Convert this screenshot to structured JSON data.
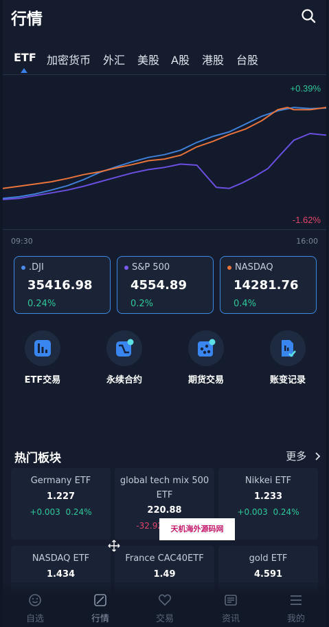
{
  "header": {
    "title": "行情",
    "search_icon": "search-icon"
  },
  "tabs": [
    {
      "label": "ETF",
      "active": true
    },
    {
      "label": "加密货币",
      "active": false
    },
    {
      "label": "外汇",
      "active": false
    },
    {
      "label": "美股",
      "active": false
    },
    {
      "label": "A股",
      "active": false
    },
    {
      "label": "港股",
      "active": false
    },
    {
      "label": "台股",
      "active": false
    }
  ],
  "chart_data": {
    "type": "line",
    "x_range": [
      "09:30",
      "16:00"
    ],
    "top_label": "+0.39%",
    "bottom_label": "-1.62%",
    "ylim": [
      -1.62,
      0.39
    ],
    "series": [
      {
        "name": ".DJI",
        "color": "#3f7fd6",
        "x": [
          0,
          0.05,
          0.1,
          0.15,
          0.2,
          0.25,
          0.3,
          0.35,
          0.4,
          0.45,
          0.5,
          0.55,
          0.6,
          0.65,
          0.7,
          0.75,
          0.8,
          0.85,
          0.9,
          0.95,
          1
        ],
        "values": [
          -1.5,
          -1.47,
          -1.42,
          -1.35,
          -1.27,
          -1.16,
          -1.03,
          -0.93,
          -0.84,
          -0.76,
          -0.71,
          -0.63,
          -0.49,
          -0.38,
          -0.3,
          -0.16,
          -0.02,
          0.08,
          0.14,
          0.12,
          0.13
        ]
      },
      {
        "name": "S&P 500",
        "color": "#6a4fe0",
        "x": [
          0,
          0.05,
          0.1,
          0.15,
          0.2,
          0.25,
          0.3,
          0.35,
          0.4,
          0.45,
          0.5,
          0.55,
          0.6,
          0.63,
          0.66,
          0.7,
          0.74,
          0.78,
          0.82,
          0.86,
          0.9,
          0.95,
          1
        ],
        "values": [
          -1.52,
          -1.5,
          -1.45,
          -1.4,
          -1.35,
          -1.28,
          -1.2,
          -1.12,
          -1.04,
          -0.98,
          -0.94,
          -0.88,
          -0.9,
          -1.1,
          -1.3,
          -1.32,
          -1.22,
          -1.1,
          -0.96,
          -0.7,
          -0.45,
          -0.33,
          -0.36
        ]
      },
      {
        "name": "NASDAQ",
        "color": "#e8743b",
        "x": [
          0,
          0.05,
          0.1,
          0.15,
          0.2,
          0.25,
          0.3,
          0.35,
          0.4,
          0.45,
          0.5,
          0.55,
          0.6,
          0.65,
          0.7,
          0.75,
          0.8,
          0.85,
          0.88,
          0.9,
          0.95,
          1
        ],
        "values": [
          -1.32,
          -1.28,
          -1.24,
          -1.2,
          -1.14,
          -1.07,
          -1.02,
          -0.95,
          -0.89,
          -0.82,
          -0.79,
          -0.72,
          -0.57,
          -0.47,
          -0.35,
          -0.25,
          -0.1,
          0.1,
          0.14,
          0.1,
          0.1,
          0.14
        ]
      }
    ]
  },
  "indices": [
    {
      "name": ".DJI",
      "value": "35416.98",
      "change": "0.24%",
      "dot_color": "#4c8be8"
    },
    {
      "name": "S&P 500",
      "value": "4554.89",
      "change": "0.2%",
      "dot_color": "#7a5af5"
    },
    {
      "name": "NASDAQ",
      "value": "14281.76",
      "change": "0.4%",
      "dot_color": "#e8743b"
    }
  ],
  "features": [
    {
      "label": "ETF交易",
      "icon": "bar-chart-icon"
    },
    {
      "label": "永续合约",
      "icon": "perpetual-contract-icon"
    },
    {
      "label": "期货交易",
      "icon": "futures-icon"
    },
    {
      "label": "账变记录",
      "icon": "record-icon"
    }
  ],
  "hot_sectors": {
    "title": "热门板块",
    "more": "更多",
    "items": [
      {
        "name": "Germany ETF",
        "price": "1.227",
        "change": "+0.003",
        "percent": "0.24%",
        "direction": "up"
      },
      {
        "name": "global tech mix 500 ETF",
        "price": "220.88",
        "change": "-32.925",
        "percent": "",
        "direction": "down"
      },
      {
        "name": "Nikkei ETF",
        "price": "1.233",
        "change": "+0.003",
        "percent": "0.24%",
        "direction": "up"
      },
      {
        "name": "NASDAQ ETF",
        "price": "1.434",
        "change": "",
        "percent": "",
        "direction": "up"
      },
      {
        "name": "France CAC40ETF",
        "price": "1.49",
        "change": "",
        "percent": "",
        "direction": "down"
      },
      {
        "name": "gold ETF",
        "price": "4.591",
        "change": "",
        "percent": "",
        "direction": "down"
      }
    ]
  },
  "watermark": "天机海外源码网",
  "bottom_nav": [
    {
      "label": "自选",
      "icon": "smile-icon",
      "active": false
    },
    {
      "label": "行情",
      "icon": "market-icon",
      "active": true
    },
    {
      "label": "交易",
      "icon": "trade-icon",
      "active": false
    },
    {
      "label": "资讯",
      "icon": "news-icon",
      "active": false
    },
    {
      "label": "我的",
      "icon": "menu-icon",
      "active": false
    }
  ],
  "colors": {
    "accent": "#3b8ae6",
    "up": "#2fc79a",
    "down": "#e2466b",
    "background": "#141c2d"
  }
}
